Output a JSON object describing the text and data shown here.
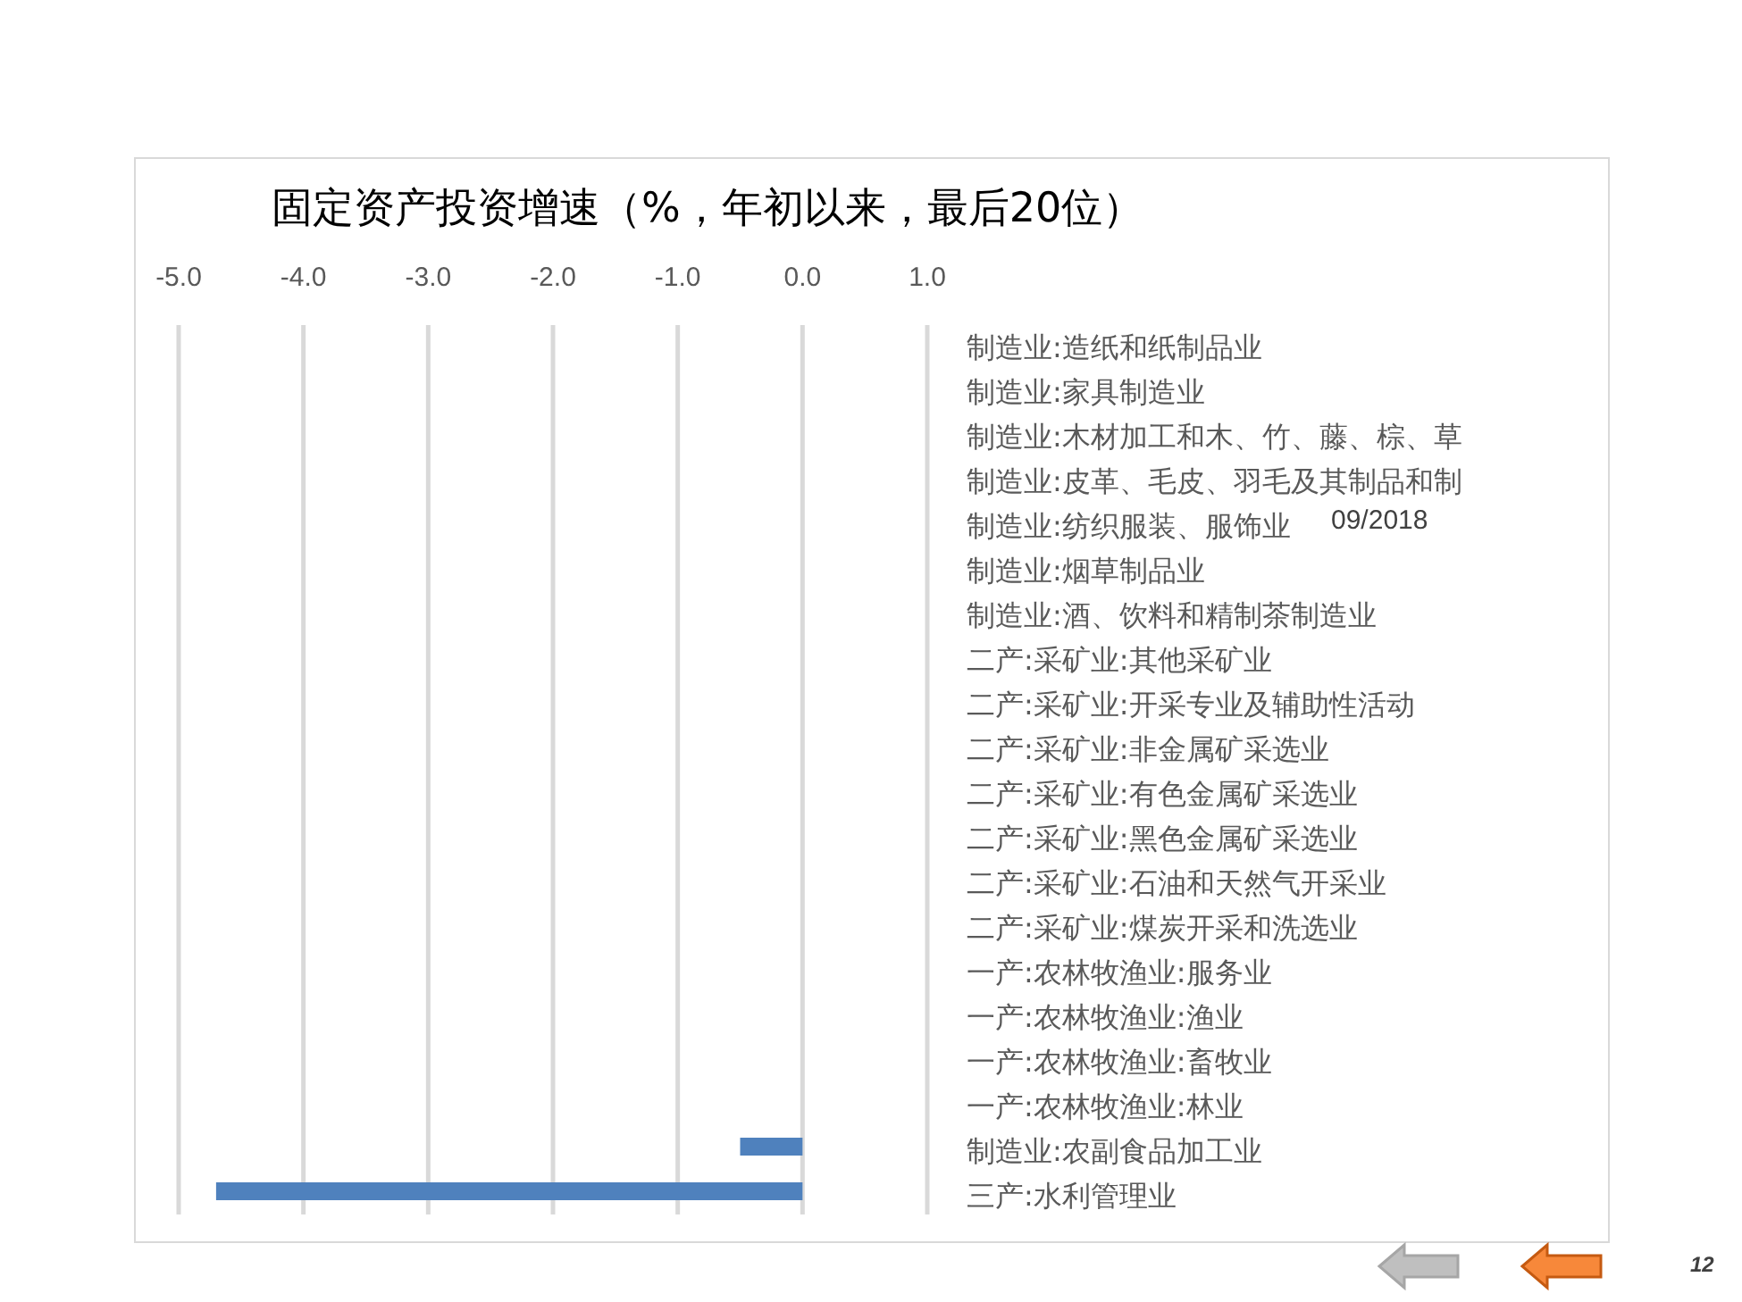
{
  "chart_data": {
    "type": "bar",
    "orientation": "horizontal",
    "title": "固定资产投资增速（%，年初以来，最后20位）",
    "categories": [
      "制造业:造纸和纸制品业",
      "制造业:家具制造业",
      "制造业:木材加工和木、竹、藤、棕、草",
      "制造业:皮革、毛皮、羽毛及其制品和制",
      "制造业:纺织服装、服饰业",
      "制造业:烟草制品业",
      "制造业:酒、饮料和精制茶制造业",
      "二产:采矿业:其他采矿业",
      "二产:采矿业:开采专业及辅助性活动",
      "二产:采矿业:非金属矿采选业",
      "二产:采矿业:有色金属矿采选业",
      "二产:采矿业:黑色金属矿采选业",
      "二产:采矿业:石油和天然气开采业",
      "二产:采矿业:煤炭开采和洗选业",
      "一产:农林牧渔业:服务业",
      "一产:农林牧渔业:渔业",
      "一产:农林牧渔业:畜牧业",
      "一产:农林牧渔业:林业",
      "制造业:农副食品加工业",
      "三产:水利管理业"
    ],
    "series": [
      {
        "name": "09/2018",
        "color": "#4f81bd",
        "values": [
          0,
          0,
          0,
          0,
          0,
          0,
          0,
          0,
          0,
          0,
          0,
          0,
          0,
          0,
          0,
          0,
          0,
          0,
          -0.5,
          -4.7
        ]
      }
    ],
    "xlim": [
      -5,
      1
    ],
    "grid": true,
    "xticks": [
      {
        "value": -5,
        "label": "-5.0"
      },
      {
        "value": -4,
        "label": "-4.0"
      },
      {
        "value": -3,
        "label": "-3.0"
      },
      {
        "value": -2,
        "label": "-2.0"
      },
      {
        "value": -1,
        "label": "-1.0"
      },
      {
        "value": 0,
        "label": "0.0"
      },
      {
        "value": 1,
        "label": "1.0"
      }
    ]
  },
  "nav_buttons": [
    {
      "disabled": true
    },
    {
      "disabled": false
    }
  ],
  "slide_number": "12"
}
